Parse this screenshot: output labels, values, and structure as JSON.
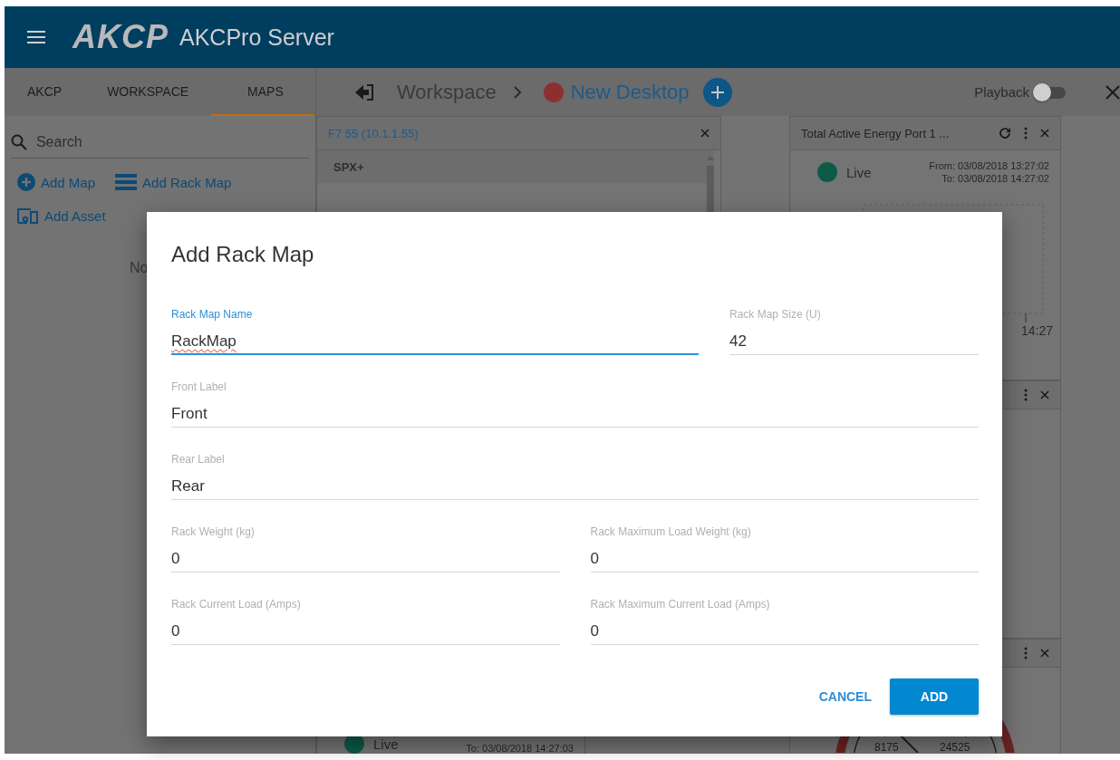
{
  "header": {
    "logo": "AKCP",
    "title": "AKCPro Server"
  },
  "tabs": [
    {
      "label": "AKCP",
      "selected": false
    },
    {
      "label": "WORKSPACE",
      "selected": false
    },
    {
      "label": "MAPS",
      "selected": true
    }
  ],
  "breadcrumb": {
    "parent": "Workspace",
    "current": "New Desktop"
  },
  "playback": {
    "label": "Playback",
    "on": false
  },
  "sidebar": {
    "search_placeholder": "Search",
    "actions": [
      {
        "label": "Add Map",
        "kind": "map"
      },
      {
        "label": "Add Rack Map",
        "kind": "rack"
      },
      {
        "label": "Add Asset",
        "kind": "asset"
      }
    ],
    "empty_text": "No"
  },
  "device_widget": {
    "title": "F7 55 (10.1.1.55)",
    "rows": [
      "SPX+"
    ]
  },
  "energy_widget": {
    "title": "Total Active Energy Port 1 ...",
    "status": "Live",
    "from": "From: 03/08/2018 13:27:02",
    "to": "To: 03/08/2018 14:27:02",
    "x_label": "14:27"
  },
  "live_widget": {
    "status": "Live",
    "to": "To: 03/08/2018 14:27:03"
  },
  "gauge_widget": {
    "labels": [
      "8175",
      "24525"
    ]
  },
  "dialog": {
    "title": "Add Rack Map",
    "field_rows": [
      [
        {
          "label": "Rack Map Name",
          "value": "RackMap",
          "focused": true,
          "misspelled": true
        },
        {
          "label": "Rack Map Size (U)",
          "value": "42",
          "focused": false,
          "misspelled": false
        }
      ],
      [
        {
          "label": "Front Label",
          "value": "Front",
          "focused": false,
          "misspelled": false
        }
      ],
      [
        {
          "label": "Rear Label",
          "value": "Rear",
          "focused": false,
          "misspelled": false
        }
      ],
      [
        {
          "label": "Rack Weight (kg)",
          "value": "0",
          "focused": false,
          "misspelled": false
        },
        {
          "label": "Rack Maximum Load Weight (kg)",
          "value": "0",
          "focused": false,
          "misspelled": false
        }
      ],
      [
        {
          "label": "Rack Current Load (Amps)",
          "value": "0",
          "focused": false,
          "misspelled": false
        },
        {
          "label": "Rack Maximum Current Load (Amps)",
          "value": "0",
          "focused": false,
          "misspelled": false
        }
      ]
    ],
    "buttons": [
      {
        "label": "CANCEL",
        "kind": "text"
      },
      {
        "label": "ADD",
        "kind": "primary"
      }
    ]
  }
}
